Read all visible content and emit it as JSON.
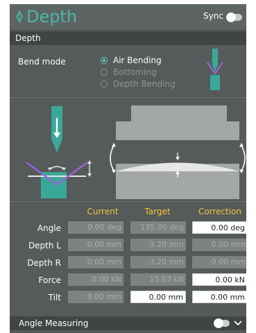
{
  "header": {
    "title": "Depth",
    "sync_label": "Sync",
    "sync_toggle_on": false,
    "accent_color": "#49b8a4"
  },
  "section": {
    "title": "Depth"
  },
  "bend_mode": {
    "label": "Bend mode",
    "options": [
      "Air Bending",
      "Bottoming",
      "Depth Bending"
    ],
    "selected": "Air Bending"
  },
  "table": {
    "columns": [
      "Current",
      "Target",
      "Correction"
    ],
    "header_color": "#f3c23a",
    "rows": [
      {
        "label": "Angle",
        "current": "0.00 deg",
        "target": "135.00 deg",
        "correction": "0.00 deg"
      },
      {
        "label": "Depth L",
        "current": "0.00 mm",
        "target": "-3.20 mm",
        "correction": "0.00 mm"
      },
      {
        "label": "Depth R",
        "current": "0.00 mm",
        "target": "-3.20 mm",
        "correction": "0.00 mm"
      },
      {
        "label": "Force",
        "current": "0.00 kN",
        "target": "15.63 kN",
        "correction": "0.00 kN"
      },
      {
        "label": "Tilt",
        "current": "0.00 mm",
        "target": "0.00 mm",
        "correction": "0.00 mm"
      }
    ]
  },
  "footer": {
    "title": "Angle Measuring",
    "toggle_on": false,
    "expand_icon": "chevron-down-icon"
  }
}
